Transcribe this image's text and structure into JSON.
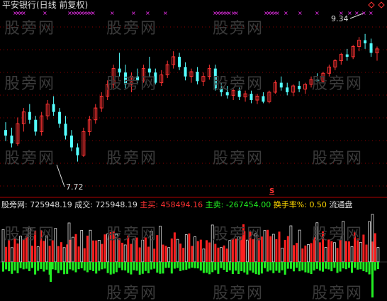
{
  "title": "平安银行(日线 前复权)",
  "price_labels": {
    "high": "9.34",
    "low": "7.72"
  },
  "watermark": "股旁网",
  "signal_glyph": "S",
  "lower_header": {
    "label1": "股旁网",
    "value1": "725948.19",
    "label2": "成交",
    "value2": "725948.19",
    "label3": "主买",
    "value3": "458494.16",
    "label4": "主卖",
    "value4": "-267454.00",
    "label5": "换手率%",
    "value5": "0.50",
    "label6": "流通盘"
  },
  "colors": {
    "up": "#ff3333",
    "down": "#54ffff",
    "buy": "#ff2020",
    "sell": "#22ee22",
    "marker": "#ff33ff",
    "grid": "#8b0000",
    "text_white": "#dddddd",
    "text_red": "#ff3333",
    "text_green": "#22ee22",
    "text_yellow": "#ffd700"
  },
  "chart_data": {
    "type": "candlestick",
    "panel": "upper",
    "ylim": [
      7.5,
      9.5
    ],
    "candles": [
      [
        8.12,
        8.22,
        7.98,
        8.05
      ],
      [
        8.05,
        8.15,
        7.9,
        7.95
      ],
      [
        7.95,
        8.28,
        7.92,
        8.2
      ],
      [
        8.2,
        8.4,
        8.1,
        8.35
      ],
      [
        8.35,
        8.45,
        8.2,
        8.25
      ],
      [
        8.25,
        8.3,
        8.05,
        8.1
      ],
      [
        8.1,
        8.35,
        8.05,
        8.3
      ],
      [
        8.3,
        8.5,
        8.25,
        8.45
      ],
      [
        8.45,
        8.55,
        8.3,
        8.35
      ],
      [
        8.35,
        8.4,
        8.15,
        8.2
      ],
      [
        8.2,
        8.3,
        8.0,
        8.05
      ],
      [
        8.05,
        8.12,
        7.85,
        7.9
      ],
      [
        7.9,
        7.95,
        7.72,
        7.8
      ],
      [
        7.8,
        8.15,
        7.78,
        8.1
      ],
      [
        8.1,
        8.3,
        8.05,
        8.25
      ],
      [
        8.25,
        8.45,
        8.2,
        8.4
      ],
      [
        8.4,
        8.6,
        8.35,
        8.55
      ],
      [
        8.55,
        8.75,
        8.5,
        8.7
      ],
      [
        8.7,
        8.95,
        8.65,
        8.9
      ],
      [
        8.9,
        9.1,
        8.8,
        8.85
      ],
      [
        8.85,
        8.95,
        8.65,
        8.7
      ],
      [
        8.7,
        8.85,
        8.6,
        8.8
      ],
      [
        8.8,
        8.9,
        8.7,
        8.75
      ],
      [
        8.75,
        8.95,
        8.72,
        8.9
      ],
      [
        8.9,
        9.05,
        8.8,
        8.85
      ],
      [
        8.85,
        8.9,
        8.7,
        8.72
      ],
      [
        8.72,
        8.88,
        8.68,
        8.82
      ],
      [
        8.82,
        9.0,
        8.78,
        8.95
      ],
      [
        8.95,
        9.12,
        8.9,
        9.05
      ],
      [
        9.05,
        9.1,
        8.88,
        8.92
      ],
      [
        8.92,
        8.98,
        8.75,
        8.8
      ],
      [
        8.8,
        8.9,
        8.72,
        8.86
      ],
      [
        8.86,
        8.92,
        8.7,
        8.74
      ],
      [
        8.74,
        8.85,
        8.68,
        8.8
      ],
      [
        8.8,
        8.95,
        8.76,
        8.9
      ],
      [
        8.9,
        8.95,
        8.62,
        8.65
      ],
      [
        8.65,
        8.72,
        8.55,
        8.6
      ],
      [
        8.6,
        8.68,
        8.52,
        8.56
      ],
      [
        8.56,
        8.64,
        8.5,
        8.62
      ],
      [
        8.62,
        8.66,
        8.5,
        8.54
      ],
      [
        8.54,
        8.62,
        8.48,
        8.58
      ],
      [
        8.58,
        8.62,
        8.46,
        8.5
      ],
      [
        8.5,
        8.58,
        8.45,
        8.55
      ],
      [
        8.55,
        8.6,
        8.46,
        8.48
      ],
      [
        8.48,
        8.62,
        8.46,
        8.6
      ],
      [
        8.6,
        8.75,
        8.58,
        8.72
      ],
      [
        8.72,
        8.8,
        8.62,
        8.66
      ],
      [
        8.66,
        8.72,
        8.56,
        8.6
      ],
      [
        8.6,
        8.7,
        8.55,
        8.68
      ],
      [
        8.68,
        8.74,
        8.6,
        8.64
      ],
      [
        8.64,
        8.72,
        8.58,
        8.7
      ],
      [
        8.7,
        8.8,
        8.66,
        8.76
      ],
      [
        8.76,
        8.84,
        8.7,
        8.74
      ],
      [
        8.74,
        8.86,
        8.72,
        8.84
      ],
      [
        8.84,
        8.95,
        8.8,
        8.92
      ],
      [
        8.92,
        9.02,
        8.88,
        9.0
      ],
      [
        9.0,
        9.1,
        8.95,
        9.08
      ],
      [
        9.08,
        9.15,
        9.0,
        9.05
      ],
      [
        9.05,
        9.2,
        9.02,
        9.18
      ],
      [
        9.18,
        9.3,
        9.12,
        9.26
      ],
      [
        9.26,
        9.34,
        9.15,
        9.22
      ],
      [
        9.22,
        9.28,
        9.05,
        9.1
      ],
      [
        9.1,
        9.18,
        9.0,
        9.15
      ]
    ]
  }
}
